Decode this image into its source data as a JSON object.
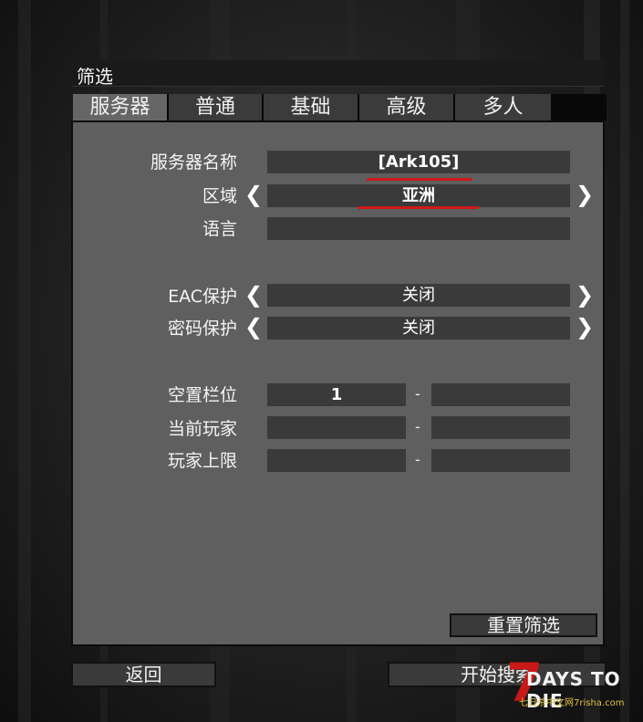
{
  "window": {
    "title": "筛选"
  },
  "tabs": [
    {
      "label": "服务器",
      "active": true
    },
    {
      "label": "普通"
    },
    {
      "label": "基础"
    },
    {
      "label": "高级"
    },
    {
      "label": "多人"
    }
  ],
  "filters": {
    "server_name": {
      "label": "服务器名称",
      "value": "[Ark105]"
    },
    "region": {
      "label": "区域",
      "value": "亚洲"
    },
    "language": {
      "label": "语言",
      "value": ""
    },
    "eac": {
      "label": "EAC保护",
      "value": "关闭"
    },
    "password": {
      "label": "密码保护",
      "value": "关闭"
    },
    "free_slots": {
      "label": "空置栏位",
      "min": "1",
      "max": ""
    },
    "current_players": {
      "label": "当前玩家",
      "min": "",
      "max": ""
    },
    "max_players": {
      "label": "玩家上限",
      "min": "",
      "max": ""
    },
    "range_separator": "-"
  },
  "buttons": {
    "reset": "重置筛选",
    "back": "返回",
    "start_search": "开始搜索"
  },
  "watermark": {
    "seven": "7",
    "name": "DAYS TO DIE",
    "site": "七日杀中文网7risha.com"
  },
  "colors": {
    "underline": "#d01818",
    "panel": "#5f5f5f",
    "field": "#3a3a3a"
  }
}
